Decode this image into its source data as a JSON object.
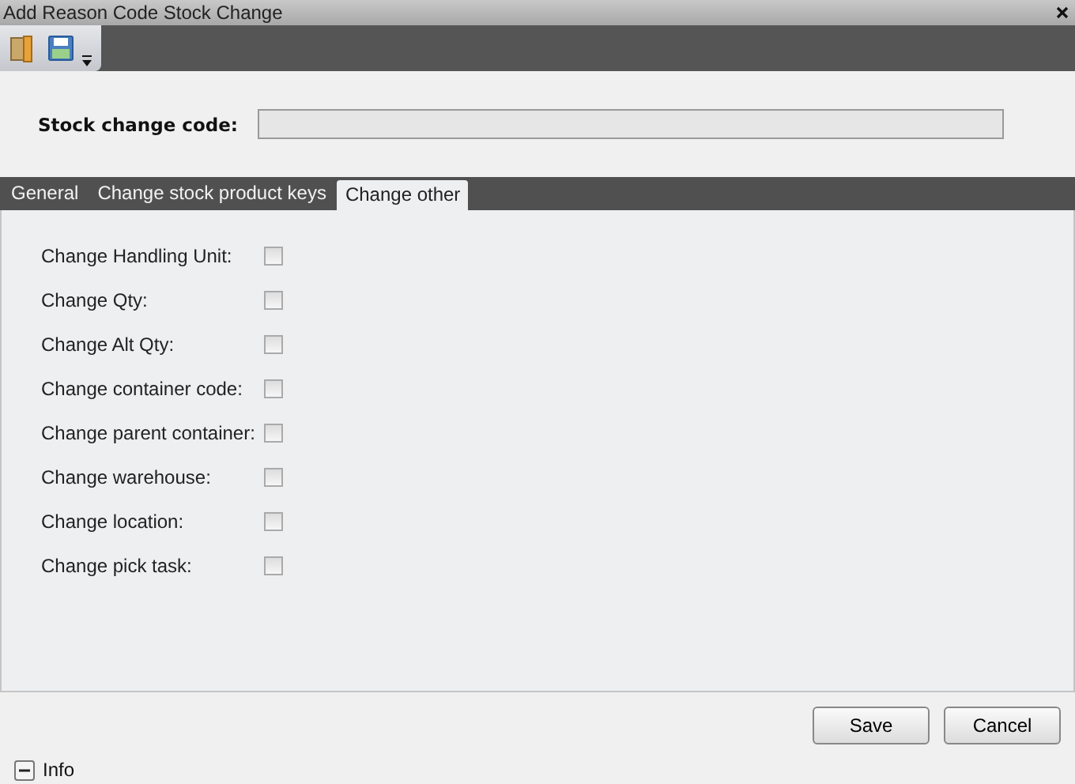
{
  "window": {
    "title": "Add Reason Code Stock Change"
  },
  "form": {
    "label": "Stock change code:"
  },
  "tabs": [
    {
      "label": "General",
      "selected": false
    },
    {
      "label": "Change stock product keys",
      "selected": false
    },
    {
      "label": "Change other",
      "selected": true
    }
  ],
  "options": [
    {
      "label": "Change Handling Unit:",
      "checked": false
    },
    {
      "label": "Change Qty:",
      "checked": false
    },
    {
      "label": "Change Alt Qty:",
      "checked": false
    },
    {
      "label": "Change container code:",
      "checked": false
    },
    {
      "label": "Change parent container:",
      "checked": false
    },
    {
      "label": "Change warehouse:",
      "checked": false
    },
    {
      "label": "Change location:",
      "checked": false
    },
    {
      "label": "Change pick task:",
      "checked": false
    }
  ],
  "buttons": [
    "Save",
    "Cancel"
  ],
  "info": {
    "label": "Info",
    "expanded": true
  }
}
